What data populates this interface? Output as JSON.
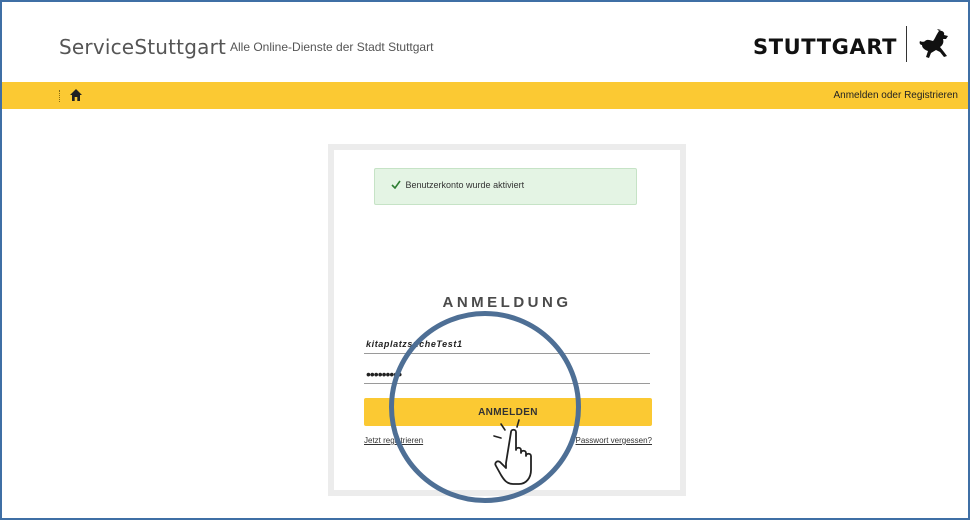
{
  "header": {
    "brand": "ServiceStuttgart",
    "tagline": "Alle Online-Dienste der Stadt Stuttgart",
    "logo_text": "STUTTGART",
    "logo_icon": "stuttgart-horse-crest"
  },
  "navbar": {
    "home_icon": "home-icon",
    "login_link": "Anmelden oder Registrieren"
  },
  "login": {
    "alert_icon": "check-icon",
    "alert_text": "Benutzerkonto wurde aktiviert",
    "title": "ANMELDUNG",
    "username_value": "kitaplatzsucheTest1",
    "password_masked": "•••••••••",
    "submit_label": "ANMELDEN",
    "register_link": "Jetzt registrieren",
    "forgot_link": "Passwort vergessen?"
  },
  "overlay": {
    "pointer_icon": "hand-pointer-icon"
  },
  "colors": {
    "accent_yellow": "#fbc933",
    "frame_blue": "#3f6fa5",
    "highlight_ring": "#4e6f95",
    "success_bg": "#e4f4e4"
  }
}
